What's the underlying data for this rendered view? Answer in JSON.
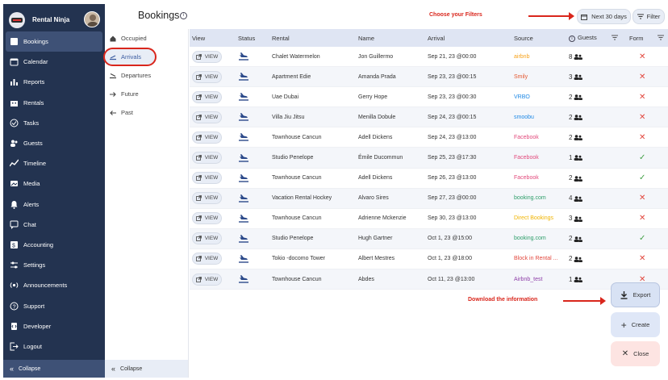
{
  "brand": {
    "name": "Rental Ninja"
  },
  "nav": [
    {
      "label": "Bookings",
      "icon": "bookings-icon",
      "active": true
    },
    {
      "label": "Calendar",
      "icon": "calendar-icon"
    },
    {
      "label": "Reports",
      "icon": "reports-icon"
    },
    {
      "label": "Rentals",
      "icon": "rentals-icon"
    },
    {
      "label": "Tasks",
      "icon": "tasks-icon"
    },
    {
      "label": "Guests",
      "icon": "guests-icon"
    },
    {
      "label": "Timeline",
      "icon": "timeline-icon"
    },
    {
      "label": "Media",
      "icon": "media-icon"
    },
    {
      "label": "Alerts",
      "icon": "alerts-icon"
    },
    {
      "label": "Chat",
      "icon": "chat-icon"
    },
    {
      "label": "Accounting",
      "icon": "accounting-icon"
    },
    {
      "label": "Settings",
      "icon": "settings-icon"
    },
    {
      "label": "Announcements",
      "icon": "announcements-icon"
    },
    {
      "label": "Support",
      "icon": "support-icon"
    },
    {
      "label": "Developer",
      "icon": "developer-icon"
    },
    {
      "label": "Logout",
      "icon": "logout-icon"
    }
  ],
  "sidebar": {
    "collapse_label": "Collapse"
  },
  "subnav": {
    "items": [
      "Occupied",
      "Arrivals",
      "Departures",
      "Future",
      "Past"
    ],
    "collapse_label": "Collapse"
  },
  "header": {
    "title": "Bookings",
    "hint_filters": "Choose your Filters",
    "period_label": "Next 30 days",
    "filter_label": "Filter"
  },
  "table": {
    "columns": [
      "View",
      "Status",
      "Rental",
      "Name",
      "Arrival",
      "Source",
      "Guests",
      "Form"
    ],
    "view_label": "VIEW",
    "rows": [
      {
        "rental": "Chalet Watermelon",
        "name": "Jon Guillermo",
        "arrival": "Sep 21, 23 @00:00",
        "source": "airbnb",
        "source_color": "#f7a21b",
        "guests": "8",
        "form": "x"
      },
      {
        "rental": "Apartment Edie",
        "name": "Amanda Prada",
        "arrival": "Sep 23, 23 @00:15",
        "source": "Smily",
        "source_color": "#e4572e",
        "guests": "3",
        "form": "x"
      },
      {
        "rental": "Uae Dubai",
        "name": "Gerry Hope",
        "arrival": "Sep 23, 23 @00:30",
        "source": "VRBO",
        "source_color": "#1e88e5",
        "guests": "2",
        "form": "x"
      },
      {
        "rental": "Villa Jiu Jitsu",
        "name": "Menilla Dobule",
        "arrival": "Sep 24, 23 @00:15",
        "source": "smoobu",
        "source_color": "#1e88e5",
        "guests": "2",
        "form": "x"
      },
      {
        "rental": "Townhouse Cancun",
        "name": "Adell Dickens",
        "arrival": "Sep 24, 23 @13:00",
        "source": "Facebook",
        "source_color": "#e24a7c",
        "guests": "2",
        "form": "x"
      },
      {
        "rental": "Studio Penelope",
        "name": "Émile Ducommun",
        "arrival": "Sep 25, 23 @17:30",
        "source": "Facebook",
        "source_color": "#e24a7c",
        "guests": "1",
        "form": "check"
      },
      {
        "rental": "Townhouse Cancun",
        "name": "Adell Dickens",
        "arrival": "Sep 26, 23 @13:00",
        "source": "Facebook",
        "source_color": "#e24a7c",
        "guests": "2",
        "form": "check"
      },
      {
        "rental": "Vacation Rental Hockey",
        "name": "Alvaro Sires",
        "arrival": "Sep 27, 23 @00:00",
        "source": "booking.com",
        "source_color": "#2e9e6a",
        "guests": "4",
        "form": "x"
      },
      {
        "rental": "Townhouse Cancun",
        "name": "Adrienne Mckenzie",
        "arrival": "Sep 30, 23 @13:00",
        "source": "Direct Bookings",
        "source_color": "#f0b400",
        "guests": "3",
        "form": "x"
      },
      {
        "rental": "Studio Penelope",
        "name": "Hugh Gartner",
        "arrival": "Oct 1, 23 @15:00",
        "source": "booking.com",
        "source_color": "#2e9e6a",
        "guests": "2",
        "form": "check"
      },
      {
        "rental": "Tokio -docomo Tower",
        "name": "Albert Mestres",
        "arrival": "Oct 1, 23 @18:00",
        "source": "Block in Rental ...",
        "source_color": "#e2473d",
        "guests": "2",
        "form": "x"
      },
      {
        "rental": "Townhouse Cancun",
        "name": "Abdes",
        "arrival": "Oct 11, 23 @13:00",
        "source": "Airbnb_test",
        "source_color": "#8e3fa8",
        "guests": "1",
        "form": "x"
      }
    ]
  },
  "actions": {
    "hint_download": "Download the information",
    "export_label": "Export",
    "create_label": "Create",
    "close_label": "Close"
  }
}
